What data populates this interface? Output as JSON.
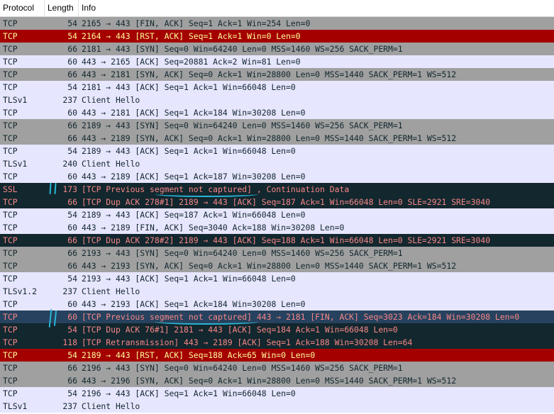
{
  "header": {
    "protocol": "Protocol",
    "length": "Length",
    "info": "Info"
  },
  "colors": {
    "gray": "#a0a0a0",
    "lavender": "#e7e6ff",
    "red": "#a40000",
    "dark": "#12272e",
    "selected": "#27425e",
    "annotation": "#29b6d6"
  },
  "rows": [
    {
      "protocol": "TCP",
      "length": "54",
      "info": "2165 → 443 [FIN, ACK] Seq=1 Ack=1 Win=254 Len=0",
      "style": "gray"
    },
    {
      "protocol": "TCP",
      "length": "54",
      "info": "2164 → 443 [RST, ACK] Seq=1 Ack=1 Win=0 Len=0",
      "style": "red"
    },
    {
      "protocol": "TCP",
      "length": "66",
      "info": "2181 → 443 [SYN] Seq=0 Win=64240 Len=0 MSS=1460 WS=256 SACK_PERM=1",
      "style": "gray"
    },
    {
      "protocol": "TCP",
      "length": "60",
      "info": "443 → 2165 [ACK] Seq=20881 Ack=2 Win=81 Len=0",
      "style": "lavender"
    },
    {
      "protocol": "TCP",
      "length": "66",
      "info": "443 → 2181 [SYN, ACK] Seq=0 Ack=1 Win=28800 Len=0 MSS=1440 SACK_PERM=1 WS=512",
      "style": "gray"
    },
    {
      "protocol": "TCP",
      "length": "54",
      "info": "2181 → 443 [ACK] Seq=1 Ack=1 Win=66048 Len=0",
      "style": "lavender"
    },
    {
      "protocol": "TLSv1",
      "length": "237",
      "info": "Client Hello",
      "style": "lavender"
    },
    {
      "protocol": "TCP",
      "length": "60",
      "info": "443 → 2181 [ACK] Seq=1 Ack=184 Win=30208 Len=0",
      "style": "lavender"
    },
    {
      "protocol": "TCP",
      "length": "66",
      "info": "2189 → 443 [SYN] Seq=0 Win=64240 Len=0 MSS=1460 WS=256 SACK_PERM=1",
      "style": "gray"
    },
    {
      "protocol": "TCP",
      "length": "66",
      "info": "443 → 2189 [SYN, ACK] Seq=0 Ack=1 Win=28800 Len=0 MSS=1440 SACK_PERM=1 WS=512",
      "style": "gray"
    },
    {
      "protocol": "TCP",
      "length": "54",
      "info": "2189 → 443 [ACK] Seq=1 Ack=1 Win=66048 Len=0",
      "style": "lavender"
    },
    {
      "protocol": "TLSv1",
      "length": "240",
      "info": "Client Hello",
      "style": "lavender"
    },
    {
      "protocol": "TCP",
      "length": "60",
      "info": "443 → 2189 [ACK] Seq=1 Ack=187 Win=30208 Len=0",
      "style": "lavender"
    },
    {
      "protocol": "SSL",
      "length": "173",
      "info": "[TCP Previous segment not captured] , Continuation Data",
      "style": "dark"
    },
    {
      "protocol": "TCP",
      "length": "66",
      "info": "[TCP Dup ACK 278#1] 2189 → 443 [ACK] Seq=187 Ack=1 Win=66048 Len=0 SLE=2921 SRE=3040",
      "style": "dark"
    },
    {
      "protocol": "TCP",
      "length": "54",
      "info": "2189 → 443 [ACK] Seq=187 Ack=1 Win=66048 Len=0",
      "style": "lavender"
    },
    {
      "protocol": "TCP",
      "length": "60",
      "info": "443 → 2189 [FIN, ACK] Seq=3040 Ack=188 Win=30208 Len=0",
      "style": "lavender"
    },
    {
      "protocol": "TCP",
      "length": "66",
      "info": "[TCP Dup ACK 278#2] 2189 → 443 [ACK] Seq=188 Ack=1 Win=66048 Len=0 SLE=2921 SRE=3040",
      "style": "dark"
    },
    {
      "protocol": "TCP",
      "length": "66",
      "info": "2193 → 443 [SYN] Seq=0 Win=64240 Len=0 MSS=1460 WS=256 SACK_PERM=1",
      "style": "gray"
    },
    {
      "protocol": "TCP",
      "length": "66",
      "info": "443 → 2193 [SYN, ACK] Seq=0 Ack=1 Win=28800 Len=0 MSS=1440 SACK_PERM=1 WS=512",
      "style": "gray"
    },
    {
      "protocol": "TCP",
      "length": "54",
      "info": "2193 → 443 [ACK] Seq=1 Ack=1 Win=66048 Len=0",
      "style": "lavender"
    },
    {
      "protocol": "TLSv1.2",
      "length": "237",
      "info": "Client Hello",
      "style": "lavender"
    },
    {
      "protocol": "TCP",
      "length": "60",
      "info": "443 → 2193 [ACK] Seq=1 Ack=184 Win=30208 Len=0",
      "style": "lavender"
    },
    {
      "protocol": "TCP",
      "length": "60",
      "info": "[TCP Previous segment not captured] 443 → 2181 [FIN, ACK] Seq=3023 Ack=184 Win=30208 Len=0",
      "style": "selected"
    },
    {
      "protocol": "TCP",
      "length": "54",
      "info": "[TCP Dup ACK 76#1] 2181 → 443 [ACK] Seq=184 Ack=1 Win=66048 Len=0",
      "style": "dark"
    },
    {
      "protocol": "TCP",
      "length": "118",
      "info": "[TCP Retransmission] 443 → 2189 [ACK] Seq=1 Ack=188 Win=30208 Len=64",
      "style": "dark"
    },
    {
      "protocol": "TCP",
      "length": "54",
      "info": "2189 → 443 [RST, ACK] Seq=188 Ack=65 Win=0 Len=0",
      "style": "red"
    },
    {
      "protocol": "TCP",
      "length": "66",
      "info": "2196 → 443 [SYN] Seq=0 Win=64240 Len=0 MSS=1460 WS=256 SACK_PERM=1",
      "style": "gray"
    },
    {
      "protocol": "TCP",
      "length": "66",
      "info": "443 → 2196 [SYN, ACK] Seq=0 Ack=1 Win=28800 Len=0 MSS=1440 SACK_PERM=1 WS=512",
      "style": "gray"
    },
    {
      "protocol": "TCP",
      "length": "54",
      "info": "2196 → 443 [ACK] Seq=1 Ack=1 Win=66048 Len=0",
      "style": "lavender"
    },
    {
      "protocol": "TLSv1",
      "length": "237",
      "info": "Client Hello",
      "style": "lavender"
    }
  ]
}
